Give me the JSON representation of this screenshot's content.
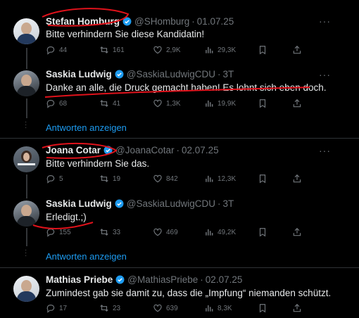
{
  "show_replies_label": "Antworten anzeigen",
  "more_label": "···",
  "tweets": [
    {
      "name": "Stefan Homburg",
      "handle": "@SHomburg",
      "date": "01.07.25",
      "text": "Bitte verhindern Sie diese Kandidatin!",
      "replies": "44",
      "reposts": "161",
      "likes": "2,9K",
      "views": "29,3K"
    },
    {
      "name": "Saskia Ludwig",
      "handle": "@SaskiaLudwigCDU",
      "date": "3T",
      "text": "Danke an alle, die Druck gemacht haben! Es lohnt sich eben doch.",
      "replies": "68",
      "reposts": "41",
      "likes": "1,3K",
      "views": "19,9K"
    },
    {
      "name": "Joana Cotar",
      "handle": "@JoanaCotar",
      "date": "02.07.25",
      "text": "Bitte verhindern Sie das.",
      "replies": "5",
      "reposts": "19",
      "likes": "842",
      "views": "12,3K"
    },
    {
      "name": "Saskia Ludwig",
      "handle": "@SaskiaLudwigCDU",
      "date": "3T",
      "text": "Erledigt.;)",
      "replies": "155",
      "reposts": "33",
      "likes": "469",
      "views": "49,2K"
    },
    {
      "name": "Mathias Priebe",
      "handle": "@MathiasPriebe",
      "date": "02.07.25",
      "text": "Zumindest gab sie damit zu, dass die „Impfung“ niemanden schützt.",
      "replies": "17",
      "reposts": "23",
      "likes": "639",
      "views": "8,3K"
    }
  ],
  "colors": {
    "background": "#000000",
    "link": "#1d9bf0",
    "muted": "#71767b",
    "annotation": "#e0121b"
  }
}
